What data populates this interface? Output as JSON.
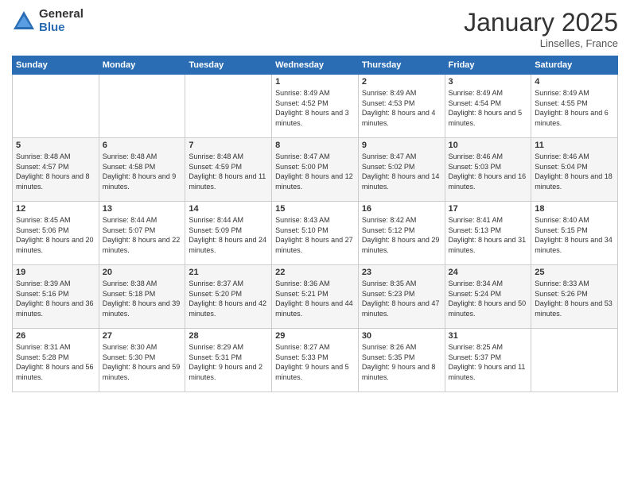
{
  "header": {
    "logo_general": "General",
    "logo_blue": "Blue",
    "month": "January 2025",
    "location": "Linselles, France"
  },
  "weekdays": [
    "Sunday",
    "Monday",
    "Tuesday",
    "Wednesday",
    "Thursday",
    "Friday",
    "Saturday"
  ],
  "weeks": [
    [
      {
        "day": "",
        "sunrise": "",
        "sunset": "",
        "daylight": ""
      },
      {
        "day": "",
        "sunrise": "",
        "sunset": "",
        "daylight": ""
      },
      {
        "day": "",
        "sunrise": "",
        "sunset": "",
        "daylight": ""
      },
      {
        "day": "1",
        "sunrise": "Sunrise: 8:49 AM",
        "sunset": "Sunset: 4:52 PM",
        "daylight": "Daylight: 8 hours and 3 minutes."
      },
      {
        "day": "2",
        "sunrise": "Sunrise: 8:49 AM",
        "sunset": "Sunset: 4:53 PM",
        "daylight": "Daylight: 8 hours and 4 minutes."
      },
      {
        "day": "3",
        "sunrise": "Sunrise: 8:49 AM",
        "sunset": "Sunset: 4:54 PM",
        "daylight": "Daylight: 8 hours and 5 minutes."
      },
      {
        "day": "4",
        "sunrise": "Sunrise: 8:49 AM",
        "sunset": "Sunset: 4:55 PM",
        "daylight": "Daylight: 8 hours and 6 minutes."
      }
    ],
    [
      {
        "day": "5",
        "sunrise": "Sunrise: 8:48 AM",
        "sunset": "Sunset: 4:57 PM",
        "daylight": "Daylight: 8 hours and 8 minutes."
      },
      {
        "day": "6",
        "sunrise": "Sunrise: 8:48 AM",
        "sunset": "Sunset: 4:58 PM",
        "daylight": "Daylight: 8 hours and 9 minutes."
      },
      {
        "day": "7",
        "sunrise": "Sunrise: 8:48 AM",
        "sunset": "Sunset: 4:59 PM",
        "daylight": "Daylight: 8 hours and 11 minutes."
      },
      {
        "day": "8",
        "sunrise": "Sunrise: 8:47 AM",
        "sunset": "Sunset: 5:00 PM",
        "daylight": "Daylight: 8 hours and 12 minutes."
      },
      {
        "day": "9",
        "sunrise": "Sunrise: 8:47 AM",
        "sunset": "Sunset: 5:02 PM",
        "daylight": "Daylight: 8 hours and 14 minutes."
      },
      {
        "day": "10",
        "sunrise": "Sunrise: 8:46 AM",
        "sunset": "Sunset: 5:03 PM",
        "daylight": "Daylight: 8 hours and 16 minutes."
      },
      {
        "day": "11",
        "sunrise": "Sunrise: 8:46 AM",
        "sunset": "Sunset: 5:04 PM",
        "daylight": "Daylight: 8 hours and 18 minutes."
      }
    ],
    [
      {
        "day": "12",
        "sunrise": "Sunrise: 8:45 AM",
        "sunset": "Sunset: 5:06 PM",
        "daylight": "Daylight: 8 hours and 20 minutes."
      },
      {
        "day": "13",
        "sunrise": "Sunrise: 8:44 AM",
        "sunset": "Sunset: 5:07 PM",
        "daylight": "Daylight: 8 hours and 22 minutes."
      },
      {
        "day": "14",
        "sunrise": "Sunrise: 8:44 AM",
        "sunset": "Sunset: 5:09 PM",
        "daylight": "Daylight: 8 hours and 24 minutes."
      },
      {
        "day": "15",
        "sunrise": "Sunrise: 8:43 AM",
        "sunset": "Sunset: 5:10 PM",
        "daylight": "Daylight: 8 hours and 27 minutes."
      },
      {
        "day": "16",
        "sunrise": "Sunrise: 8:42 AM",
        "sunset": "Sunset: 5:12 PM",
        "daylight": "Daylight: 8 hours and 29 minutes."
      },
      {
        "day": "17",
        "sunrise": "Sunrise: 8:41 AM",
        "sunset": "Sunset: 5:13 PM",
        "daylight": "Daylight: 8 hours and 31 minutes."
      },
      {
        "day": "18",
        "sunrise": "Sunrise: 8:40 AM",
        "sunset": "Sunset: 5:15 PM",
        "daylight": "Daylight: 8 hours and 34 minutes."
      }
    ],
    [
      {
        "day": "19",
        "sunrise": "Sunrise: 8:39 AM",
        "sunset": "Sunset: 5:16 PM",
        "daylight": "Daylight: 8 hours and 36 minutes."
      },
      {
        "day": "20",
        "sunrise": "Sunrise: 8:38 AM",
        "sunset": "Sunset: 5:18 PM",
        "daylight": "Daylight: 8 hours and 39 minutes."
      },
      {
        "day": "21",
        "sunrise": "Sunrise: 8:37 AM",
        "sunset": "Sunset: 5:20 PM",
        "daylight": "Daylight: 8 hours and 42 minutes."
      },
      {
        "day": "22",
        "sunrise": "Sunrise: 8:36 AM",
        "sunset": "Sunset: 5:21 PM",
        "daylight": "Daylight: 8 hours and 44 minutes."
      },
      {
        "day": "23",
        "sunrise": "Sunrise: 8:35 AM",
        "sunset": "Sunset: 5:23 PM",
        "daylight": "Daylight: 8 hours and 47 minutes."
      },
      {
        "day": "24",
        "sunrise": "Sunrise: 8:34 AM",
        "sunset": "Sunset: 5:24 PM",
        "daylight": "Daylight: 8 hours and 50 minutes."
      },
      {
        "day": "25",
        "sunrise": "Sunrise: 8:33 AM",
        "sunset": "Sunset: 5:26 PM",
        "daylight": "Daylight: 8 hours and 53 minutes."
      }
    ],
    [
      {
        "day": "26",
        "sunrise": "Sunrise: 8:31 AM",
        "sunset": "Sunset: 5:28 PM",
        "daylight": "Daylight: 8 hours and 56 minutes."
      },
      {
        "day": "27",
        "sunrise": "Sunrise: 8:30 AM",
        "sunset": "Sunset: 5:30 PM",
        "daylight": "Daylight: 8 hours and 59 minutes."
      },
      {
        "day": "28",
        "sunrise": "Sunrise: 8:29 AM",
        "sunset": "Sunset: 5:31 PM",
        "daylight": "Daylight: 9 hours and 2 minutes."
      },
      {
        "day": "29",
        "sunrise": "Sunrise: 8:27 AM",
        "sunset": "Sunset: 5:33 PM",
        "daylight": "Daylight: 9 hours and 5 minutes."
      },
      {
        "day": "30",
        "sunrise": "Sunrise: 8:26 AM",
        "sunset": "Sunset: 5:35 PM",
        "daylight": "Daylight: 9 hours and 8 minutes."
      },
      {
        "day": "31",
        "sunrise": "Sunrise: 8:25 AM",
        "sunset": "Sunset: 5:37 PM",
        "daylight": "Daylight: 9 hours and 11 minutes."
      },
      {
        "day": "",
        "sunrise": "",
        "sunset": "",
        "daylight": ""
      }
    ]
  ]
}
